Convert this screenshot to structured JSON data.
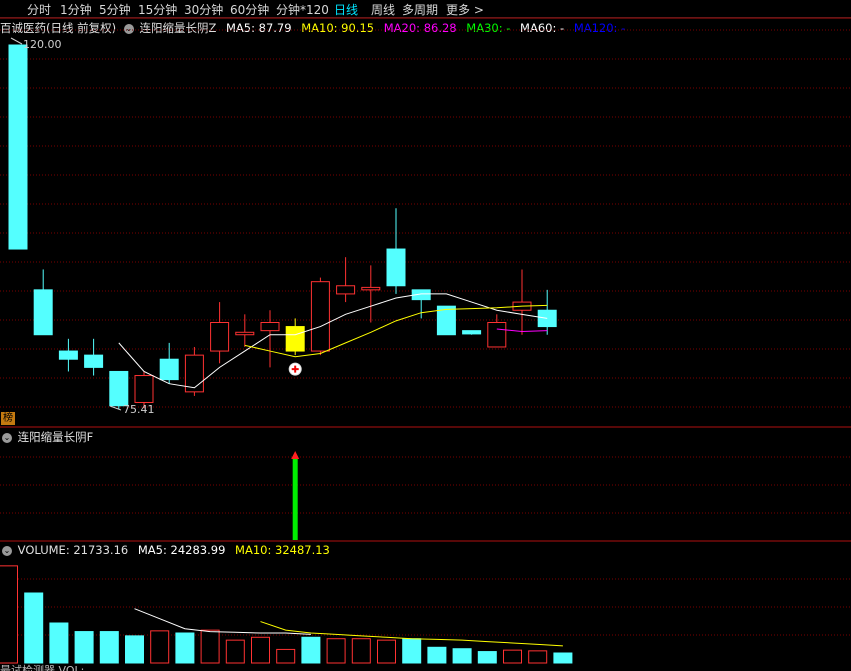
{
  "toolbar": {
    "periods": [
      "分时",
      "1分钟",
      "5分钟",
      "15分钟",
      "30分钟",
      "60分钟",
      "分钟*120",
      "日线",
      "周线",
      "多周期",
      "更多 >"
    ],
    "active_index": 7
  },
  "main_header": {
    "stock": "百诚医药(日线 前复权)",
    "indicator": "连阳缩量长阴Z",
    "ma5": "MA5: 87.79",
    "ma10": "MA10: 90.15",
    "ma20": "MA20: 86.28",
    "ma30": "MA30: -",
    "ma60": "MA60: -",
    "ma120": "MA120: -"
  },
  "indicator_header": {
    "name": "连阳缩量长阴F"
  },
  "volume_header": {
    "volume": "VOLUME: 21733.16",
    "ma5": "MA5: 24283.99",
    "ma10": "MA10: 32487.13"
  },
  "labels": {
    "high": "120.00",
    "low": "75.41",
    "badge": "榜",
    "bottom": "最试检测器    VOL:"
  },
  "colors": {
    "up": "#ff3232",
    "down": "#54ffff",
    "signal": "#ffff00",
    "grid": "#7a0000",
    "ma5": "#ffffff",
    "ma10": "#ffff00",
    "ma20": "#ff00ff",
    "ma30": "#00ff00",
    "ma60": "#ffffff",
    "ma120": "#0000ff"
  },
  "chart_data": {
    "type": "candlestick",
    "price_ylim": [
      72,
      124
    ],
    "candles": [
      {
        "o": 120.0,
        "h": 120.0,
        "l": 95.0,
        "c": 95.0
      },
      {
        "o": 90.0,
        "h": 92.5,
        "l": 84.5,
        "c": 84.5
      },
      {
        "o": 82.5,
        "h": 84.0,
        "l": 80.0,
        "c": 81.5
      },
      {
        "o": 82.0,
        "h": 84.0,
        "l": 79.5,
        "c": 80.5
      },
      {
        "o": 80.0,
        "h": 80.0,
        "l": 75.4,
        "c": 75.8
      },
      {
        "o": 76.2,
        "h": 80.0,
        "l": 75.5,
        "c": 79.5
      },
      {
        "o": 81.5,
        "h": 83.5,
        "l": 78.5,
        "c": 79.0
      },
      {
        "o": 77.5,
        "h": 83.0,
        "l": 77.0,
        "c": 82.0
      },
      {
        "o": 82.5,
        "h": 88.5,
        "l": 81.0,
        "c": 86.0
      },
      {
        "o": 84.5,
        "h": 87.0,
        "l": 83.0,
        "c": 84.8
      },
      {
        "o": 85.0,
        "h": 87.5,
        "l": 80.5,
        "c": 86.0
      },
      {
        "o": 85.5,
        "h": 86.5,
        "l": 82.0,
        "c": 82.5
      },
      {
        "o": 82.5,
        "h": 91.5,
        "l": 82.0,
        "c": 91.0
      },
      {
        "o": 89.5,
        "h": 94.0,
        "l": 88.5,
        "c": 90.5
      },
      {
        "o": 90.0,
        "h": 93.0,
        "l": 86.0,
        "c": 90.3
      },
      {
        "o": 95.0,
        "h": 100.0,
        "l": 89.5,
        "c": 90.5
      },
      {
        "o": 90.0,
        "h": 90.0,
        "l": 86.5,
        "c": 88.8
      },
      {
        "o": 88.0,
        "h": 88.0,
        "l": 84.5,
        "c": 84.5
      },
      {
        "o": 85.0,
        "h": 85.0,
        "l": 84.5,
        "c": 84.6
      },
      {
        "o": 83.0,
        "h": 87.0,
        "l": 83.0,
        "c": 86.0
      },
      {
        "o": 87.5,
        "h": 92.5,
        "l": 84.5,
        "c": 88.5
      },
      {
        "o": 87.5,
        "h": 90.0,
        "l": 84.5,
        "c": 85.5
      }
    ],
    "signal_candle_index": 11,
    "ma5": [
      [
        4,
        83.5
      ],
      [
        5,
        80
      ],
      [
        6,
        78.5
      ],
      [
        7,
        78
      ],
      [
        8,
        80.5
      ],
      [
        9,
        82.5
      ],
      [
        10,
        84.5
      ],
      [
        11,
        84.5
      ],
      [
        12,
        85.5
      ],
      [
        13,
        87
      ],
      [
        14,
        88
      ],
      [
        15,
        89
      ],
      [
        16,
        89.5
      ],
      [
        17,
        89.5
      ],
      [
        18,
        88.5
      ],
      [
        19,
        87.5
      ],
      [
        20,
        87
      ],
      [
        21,
        86.5
      ]
    ],
    "ma10": [
      [
        9,
        83.2
      ],
      [
        10,
        82.5
      ],
      [
        11,
        81.8
      ],
      [
        12,
        82.2
      ],
      [
        13,
        83.5
      ],
      [
        14,
        84.8
      ],
      [
        15,
        86.2
      ],
      [
        16,
        87.2
      ],
      [
        17,
        87.6
      ],
      [
        18,
        87.7
      ],
      [
        19,
        87.8
      ],
      [
        20,
        88
      ],
      [
        21,
        88.1
      ]
    ],
    "ma20": [
      [
        19,
        85.2
      ],
      [
        20,
        84.9
      ],
      [
        21,
        85.0
      ]
    ],
    "indicator_signal_index": 11,
    "volume": [
      68000,
      49000,
      28000,
      22000,
      22000,
      19000,
      22500,
      21000,
      23000,
      16000,
      18000,
      9500,
      18000,
      17000,
      17000,
      16000,
      17000,
      11000,
      10000,
      8000,
      9000,
      8500,
      7000
    ],
    "volume_ylim": [
      0,
      70000
    ],
    "vol_ma5": [
      [
        4,
        38000
      ],
      [
        5,
        31000
      ],
      [
        6,
        24000
      ],
      [
        7,
        22000
      ],
      [
        8,
        21500
      ],
      [
        9,
        21000
      ],
      [
        10,
        21000
      ],
      [
        11,
        20000
      ]
    ],
    "vol_ma10": [
      [
        9,
        29000
      ],
      [
        10,
        23000
      ],
      [
        11,
        21000
      ],
      [
        12,
        20000
      ],
      [
        13,
        19000
      ],
      [
        14,
        18000
      ],
      [
        15,
        17000
      ],
      [
        16,
        16500
      ],
      [
        17,
        16000
      ],
      [
        18,
        15000
      ],
      [
        19,
        14000
      ],
      [
        20,
        13000
      ],
      [
        21,
        12000
      ]
    ]
  }
}
